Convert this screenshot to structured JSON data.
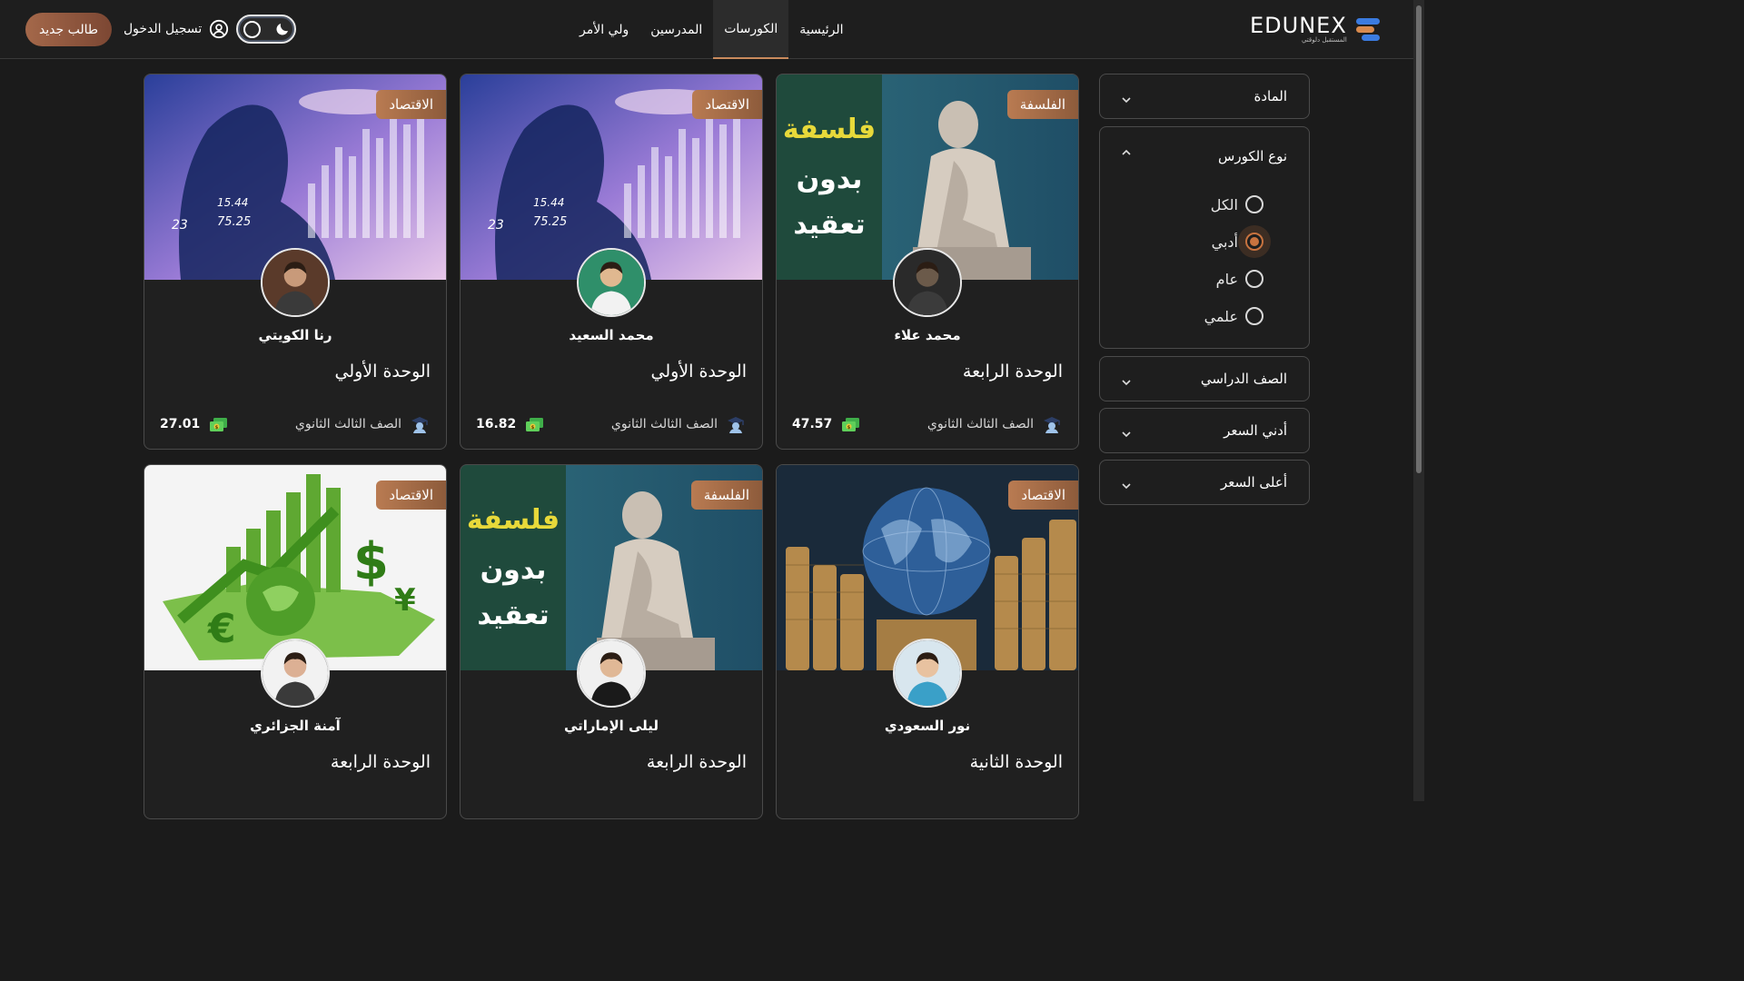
{
  "header": {
    "cta_label": "طالب جديد",
    "login_label": "تسجيل الدخول",
    "nav": [
      {
        "label": "الرئيسية",
        "active": false
      },
      {
        "label": "الكورسات",
        "active": true
      },
      {
        "label": "المدرسين",
        "active": false
      },
      {
        "label": "ولي الأمر",
        "active": false
      }
    ],
    "logo_text": "EDUNEX",
    "logo_sub": "المستقبل دلوقتي",
    "accent_color": "#c8733f"
  },
  "filters": {
    "subject": "المادة",
    "course_type": "نوع الكورس",
    "course_type_options": [
      {
        "label": "الكل",
        "checked": false
      },
      {
        "label": "أدبي",
        "checked": true
      },
      {
        "label": "عام",
        "checked": false
      },
      {
        "label": "علمي",
        "checked": false
      }
    ],
    "grade": "الصف الدراسي",
    "min_price": "أدني السعر",
    "max_price": "أعلى السعر"
  },
  "courses": [
    {
      "category": "الفلسفة",
      "teacher": "محمد علاء",
      "unit": "الوحدة الرابعة",
      "grade": "الصف الثالث الثانوي",
      "price": "47.57",
      "image": "philosophy",
      "cover_lines": [
        "فلسفة",
        "بدون",
        "تعقيد"
      ]
    },
    {
      "category": "الاقتصاد",
      "teacher": "محمد السعيد",
      "unit": "الوحدة الأولي",
      "grade": "الصف الثالث الثانوي",
      "price": "16.82",
      "image": "finance",
      "cover_lines": [
        "15.44",
        "23",
        "75.25"
      ]
    },
    {
      "category": "الاقتصاد",
      "teacher": "رنا الكويتي",
      "unit": "الوحدة الأولي",
      "grade": "الصف الثالث الثانوي",
      "price": "27.01",
      "image": "finance",
      "cover_lines": [
        "15.44",
        "23",
        "75.25"
      ]
    },
    {
      "category": "الاقتصاد",
      "teacher": "نور السعودي",
      "unit": "الوحدة الثانية",
      "grade": "",
      "price": "",
      "image": "globe",
      "cover_lines": []
    },
    {
      "category": "الفلسفة",
      "teacher": "ليلى الإماراتي",
      "unit": "الوحدة الرابعة",
      "grade": "",
      "price": "",
      "image": "philosophy",
      "cover_lines": [
        "فلسفة",
        "بدون",
        "تعقيد"
      ]
    },
    {
      "category": "الاقتصاد",
      "teacher": "آمنة الجزائري",
      "unit": "الوحدة الرابعة",
      "grade": "",
      "price": "",
      "image": "green-economy",
      "cover_lines": [
        "$",
        "€",
        "¥"
      ]
    }
  ]
}
